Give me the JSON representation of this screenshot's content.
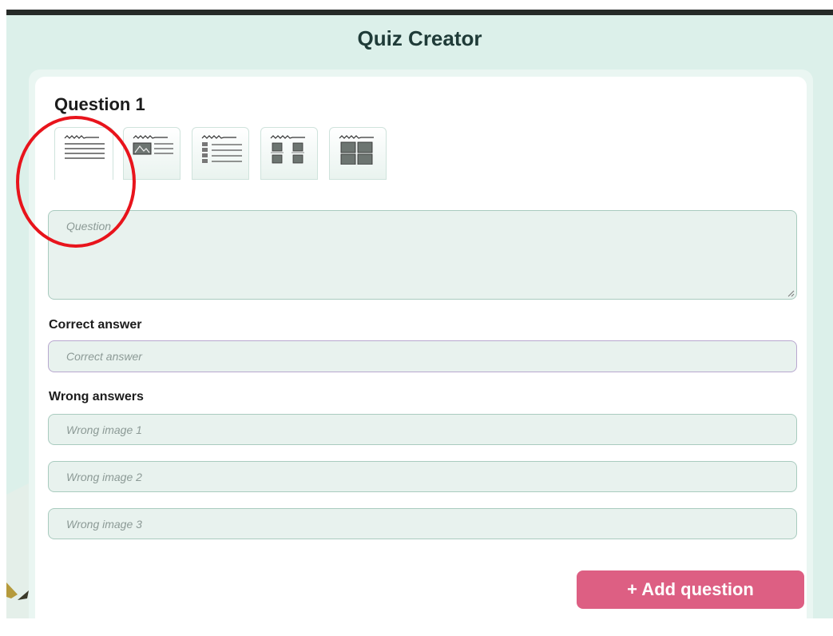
{
  "app": {
    "title": "Quiz Creator"
  },
  "question": {
    "heading": "Question 1",
    "layout_tabs": [
      {
        "icon": "text-only-layout-icon",
        "active": true
      },
      {
        "icon": "image-and-text-layout-icon",
        "active": false
      },
      {
        "icon": "text-list-layout-icon",
        "active": false
      },
      {
        "icon": "small-image-grid-layout-icon",
        "active": false
      },
      {
        "icon": "large-image-grid-layout-icon",
        "active": false
      }
    ],
    "question_placeholder": "Question"
  },
  "correct": {
    "label": "Correct answer",
    "placeholder": "Correct answer"
  },
  "wrong": {
    "label": "Wrong answers",
    "placeholders": [
      "Wrong image 1",
      "Wrong image 2",
      "Wrong image 3"
    ]
  },
  "actions": {
    "add_question": "+ Add question"
  },
  "colors": {
    "accent": "#dd5f83",
    "background": "#dcf0ea",
    "field": "#e8f2ee",
    "annotation": "#e8141c"
  }
}
